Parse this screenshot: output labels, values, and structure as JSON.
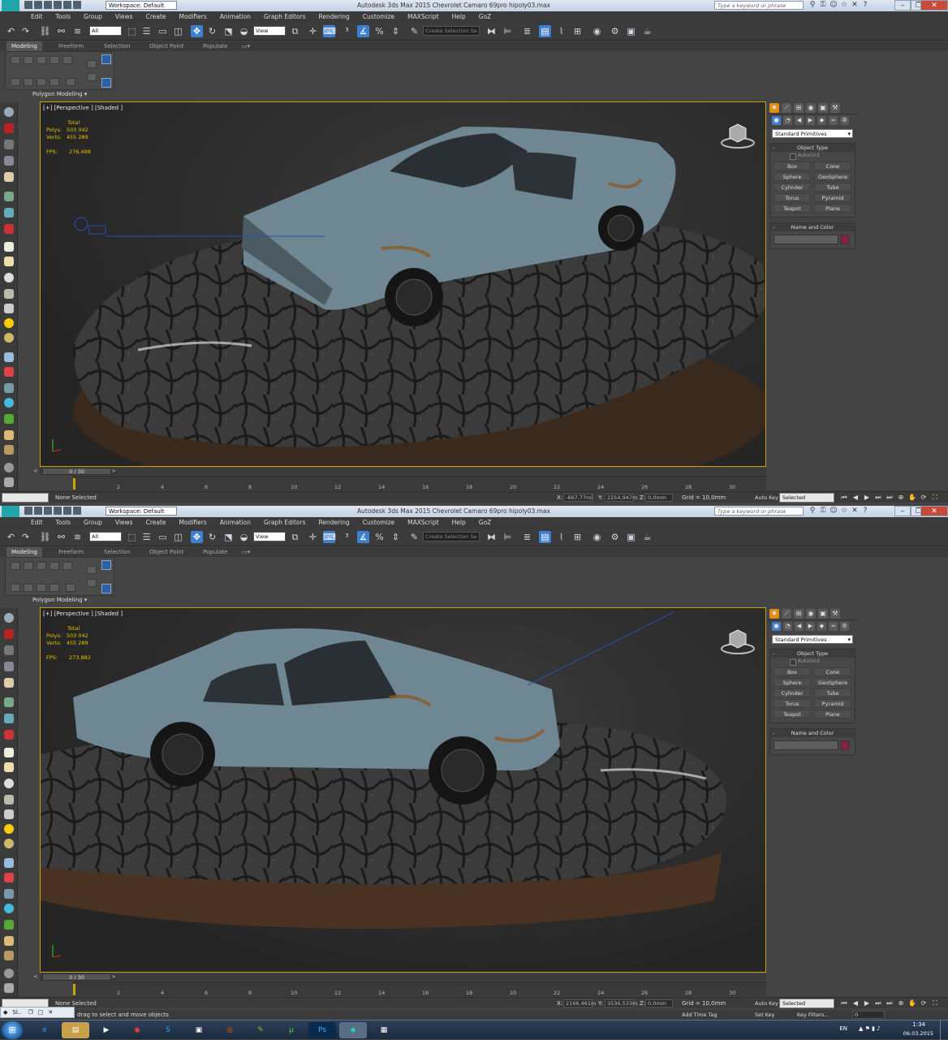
{
  "app": {
    "title": "Autodesk 3ds Max  2015     Chevrolet Camaro 69pro hipoly03.max",
    "logo": "MAX",
    "workspace": "Workspace: Default",
    "search_placeholder": "Type a keyword or phrase"
  },
  "menu": [
    "Edit",
    "Tools",
    "Group",
    "Views",
    "Create",
    "Modifiers",
    "Animation",
    "Graph Editors",
    "Rendering",
    "Customize",
    "MAXScript",
    "Help",
    "GoZ"
  ],
  "toolbar": {
    "filter": "All",
    "refcoord": "View",
    "selset_placeholder": "Create Selection Se"
  },
  "ribbon": {
    "tabs": [
      "Modeling",
      "Freeform",
      "Selection",
      "Object Paint",
      "Populate"
    ],
    "group_label": "Polygon Modeling"
  },
  "viewport": {
    "label": "[+] [Perspective ] [Shaded ]",
    "total_label": "Total",
    "polys_label": "Polys:",
    "verts_label": "Verts:",
    "fps_label": "FPS:",
    "polys_value": "503 042",
    "verts_value": "455 289",
    "fps_values": [
      "276,498",
      "273,882"
    ]
  },
  "command_panel": {
    "category": "Standard Primitives",
    "object_type_title": "Object Type",
    "autogrid": "AutoGrid",
    "buttons": [
      "Box",
      "Cone",
      "Sphere",
      "GeoSphere",
      "Cylinder",
      "Tube",
      "Torus",
      "Pyramid",
      "Teapot",
      "Plane"
    ],
    "name_color_title": "Name and Color",
    "color": "#8b1e4a"
  },
  "timeline": {
    "frame_box": "0 / 30",
    "ticks": [
      "2",
      "4",
      "6",
      "8",
      "10",
      "12",
      "14",
      "16",
      "18",
      "20",
      "22",
      "24",
      "26",
      "28",
      "30"
    ]
  },
  "status": {
    "selected": "None Selected",
    "x_label": "X:",
    "y_label": "Y:",
    "z_label": "Z:",
    "coords": [
      {
        "x": "-667,77mi",
        "y": "2254,947m",
        "z": "0,0mm"
      },
      {
        "x": "2166,461m",
        "y": "3536,533m",
        "z": "0,0mm"
      }
    ],
    "grid": "Grid = 10,0mm",
    "auto_key": "Auto Key",
    "set_key": "Set Key",
    "key_mode": "Selected",
    "key_filters": "Key Filters...",
    "add_time_tag": "Add Time Tag",
    "prompt": "Click or click-and-drag to select and move objects",
    "prompt_visible": "drag to select and move objects",
    "frame_field": "0"
  },
  "taskbar": {
    "start": "⊞",
    "mini_window": "Sl..",
    "lang": "EN",
    "time": "1:34",
    "date": "06.03.2015"
  }
}
